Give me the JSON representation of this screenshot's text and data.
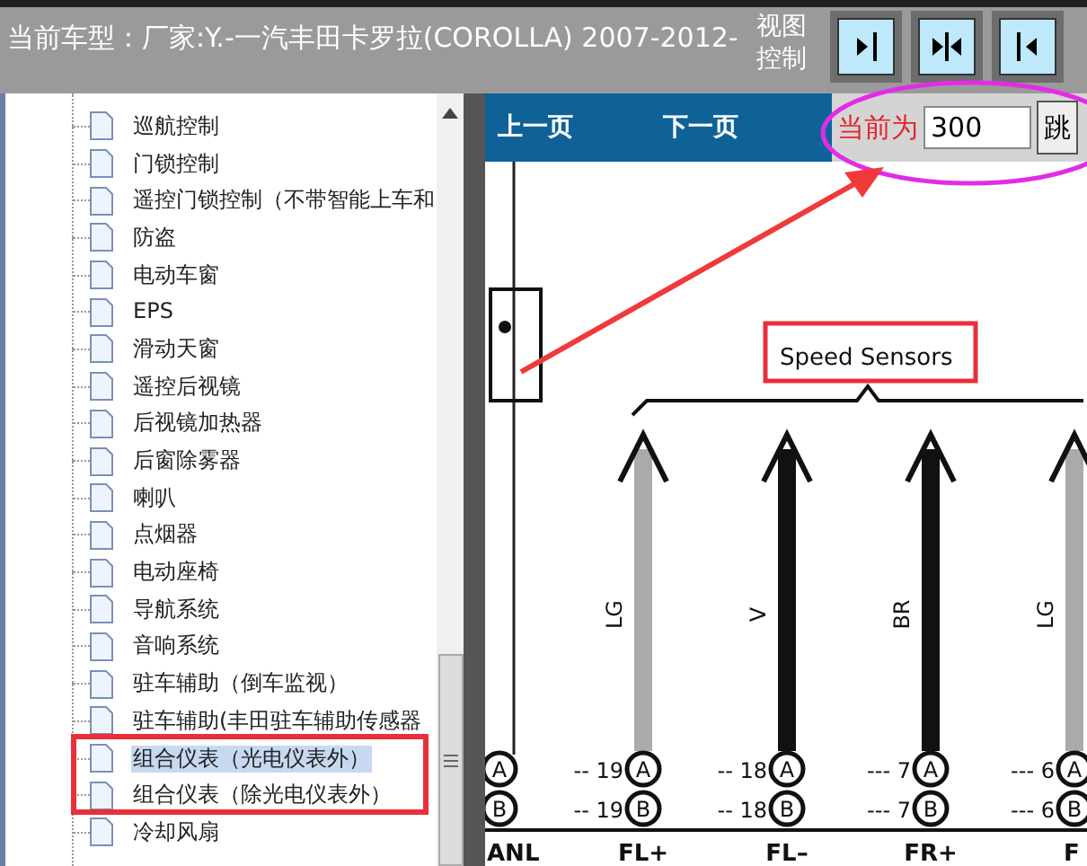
{
  "header": {
    "title": "当前车型：厂家:Y.-一汽丰田卡罗拉(COROLLA) 2007-2012-",
    "view_control_label": "视图控制",
    "view_buttons": [
      {
        "kind": "right"
      },
      {
        "kind": "both"
      },
      {
        "kind": "left"
      }
    ]
  },
  "tree": {
    "items": [
      {
        "label": "巡航控制",
        "selected": false
      },
      {
        "label": "门锁控制",
        "selected": false
      },
      {
        "label": "遥控门锁控制（不带智能上车和",
        "selected": false
      },
      {
        "label": "防盗",
        "selected": false
      },
      {
        "label": "电动车窗",
        "selected": false
      },
      {
        "label": "EPS",
        "selected": false
      },
      {
        "label": "滑动天窗",
        "selected": false
      },
      {
        "label": "遥控后视镜",
        "selected": false
      },
      {
        "label": "后视镜加热器",
        "selected": false
      },
      {
        "label": "后窗除雾器",
        "selected": false
      },
      {
        "label": "喇叭",
        "selected": false
      },
      {
        "label": "点烟器",
        "selected": false
      },
      {
        "label": "电动座椅",
        "selected": false
      },
      {
        "label": "导航系统",
        "selected": false
      },
      {
        "label": "音响系统",
        "selected": false
      },
      {
        "label": "驻车辅助（倒车监视）",
        "selected": false
      },
      {
        "label": "驻车辅助(丰田驻车辅助传感器",
        "selected": false
      },
      {
        "label": "组合仪表（光电仪表外）",
        "selected": true
      },
      {
        "label": "组合仪表（除光电仪表外）",
        "selected": false
      },
      {
        "label": "冷却风扇",
        "selected": false
      }
    ]
  },
  "toolbar": {
    "prev": "上一页",
    "next": "下一页",
    "page_label": "当前为",
    "page_value": "300",
    "jump": "跳"
  },
  "diagram": {
    "title": "Speed Sensors",
    "wires": [
      {
        "code": "LG",
        "kind": "gray"
      },
      {
        "code": "V",
        "kind": "black"
      },
      {
        "code": "BR",
        "kind": "black"
      },
      {
        "code": "LG",
        "kind": "gray"
      }
    ],
    "pin_rows": [
      {
        "pins": [
          "A",
          "A",
          "A",
          "A",
          "A"
        ],
        "links": [
          "-- 19",
          "-- 18",
          "--- 7",
          "--- 6"
        ]
      },
      {
        "pins": [
          "B",
          "B",
          "B",
          "B",
          "B"
        ],
        "links": [
          "-- 19",
          "-- 18",
          "--- 7",
          "--- 6"
        ]
      }
    ],
    "terminals": [
      "ANL",
      "FL+",
      "FL–",
      "FR+",
      "F"
    ]
  }
}
